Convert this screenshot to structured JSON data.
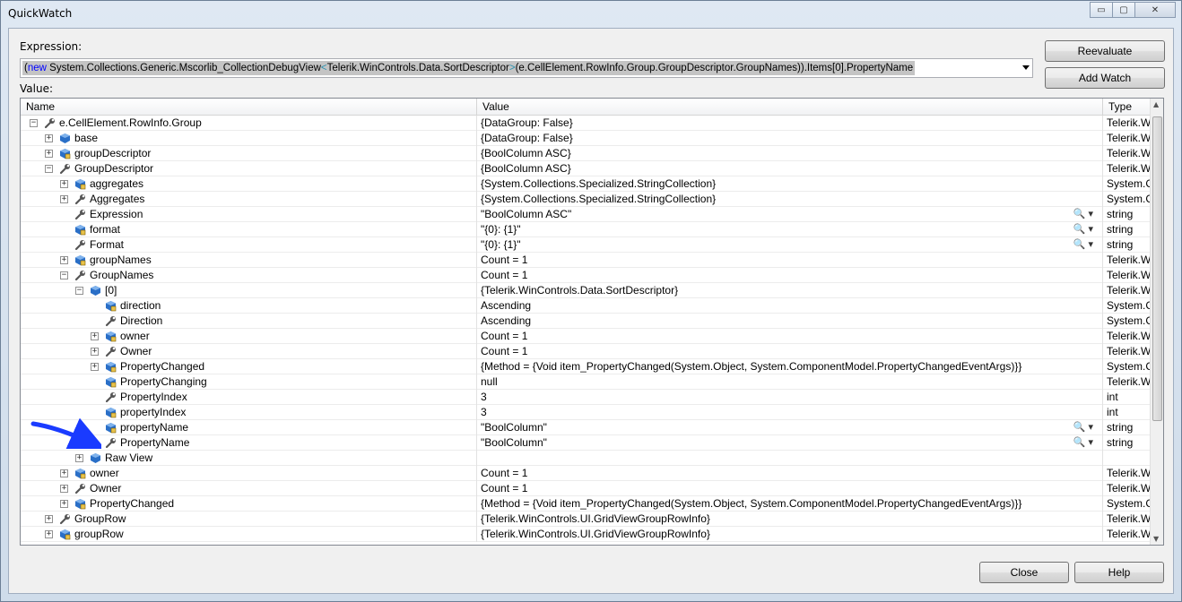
{
  "window": {
    "title": "QuickWatch",
    "minimize": "▭",
    "maximize": "▢",
    "close": "✕"
  },
  "expression": {
    "label": "Expression:",
    "parts": [
      {
        "text": "(",
        "cls": "d"
      },
      {
        "text": "new",
        "cls": "k"
      },
      {
        "text": " System.Collections.Generic.Mscorlib_CollectionDebugView",
        "cls": "d"
      },
      {
        "text": "<",
        "cls": "t"
      },
      {
        "text": "Telerik.WinControls.Data.SortDescriptor",
        "cls": "d"
      },
      {
        "text": ">",
        "cls": "t"
      },
      {
        "text": "(e.CellElement.RowInfo.Group.GroupDescriptor.GroupNames)).Items[0].PropertyName",
        "cls": "d"
      }
    ]
  },
  "buttons": {
    "reevaluate": "Reevaluate",
    "add_watch": "Add Watch",
    "close": "Close",
    "help": "Help"
  },
  "value_label": "Value:",
  "columns": {
    "name": "Name",
    "value": "Value",
    "type": "Type"
  },
  "rows": [
    {
      "depth": 0,
      "expander": "minus",
      "icon": "wrench",
      "name": "e.CellElement.RowInfo.Group",
      "value": "{DataGroup: False}",
      "type": "Telerik.W",
      "mag": false
    },
    {
      "depth": 1,
      "expander": "plus",
      "icon": "cube",
      "name": "base",
      "value": "{DataGroup: False}",
      "type": "Telerik.W",
      "mag": false
    },
    {
      "depth": 1,
      "expander": "plus",
      "icon": "cube-lock",
      "name": "groupDescriptor",
      "value": "{BoolColumn ASC}",
      "type": "Telerik.W",
      "mag": false
    },
    {
      "depth": 1,
      "expander": "minus",
      "icon": "wrench",
      "name": "GroupDescriptor",
      "value": "{BoolColumn ASC}",
      "type": "Telerik.W",
      "mag": false
    },
    {
      "depth": 2,
      "expander": "plus",
      "icon": "cube-lock",
      "name": "aggregates",
      "value": "{System.Collections.Specialized.StringCollection}",
      "type": "System.C",
      "mag": false
    },
    {
      "depth": 2,
      "expander": "plus",
      "icon": "wrench",
      "name": "Aggregates",
      "value": "{System.Collections.Specialized.StringCollection}",
      "type": "System.C",
      "mag": false
    },
    {
      "depth": 2,
      "expander": "none",
      "icon": "wrench",
      "name": "Expression",
      "value": "\"BoolColumn ASC\"",
      "type": "string",
      "mag": true
    },
    {
      "depth": 2,
      "expander": "none",
      "icon": "cube-lock",
      "name": "format",
      "value": "\"{0}: {1}\"",
      "type": "string",
      "mag": true
    },
    {
      "depth": 2,
      "expander": "none",
      "icon": "wrench",
      "name": "Format",
      "value": "\"{0}: {1}\"",
      "type": "string",
      "mag": true
    },
    {
      "depth": 2,
      "expander": "plus",
      "icon": "cube-lock",
      "name": "groupNames",
      "value": "Count = 1",
      "type": "Telerik.W",
      "mag": false
    },
    {
      "depth": 2,
      "expander": "minus",
      "icon": "wrench",
      "name": "GroupNames",
      "value": "Count = 1",
      "type": "Telerik.W",
      "mag": false
    },
    {
      "depth": 3,
      "expander": "minus",
      "icon": "cube",
      "name": "[0]",
      "value": "{Telerik.WinControls.Data.SortDescriptor}",
      "type": "Telerik.W",
      "mag": false
    },
    {
      "depth": 4,
      "expander": "none",
      "icon": "cube-lock",
      "name": "direction",
      "value": "Ascending",
      "type": "System.C",
      "mag": false
    },
    {
      "depth": 4,
      "expander": "none",
      "icon": "wrench",
      "name": "Direction",
      "value": "Ascending",
      "type": "System.C",
      "mag": false
    },
    {
      "depth": 4,
      "expander": "plus",
      "icon": "cube-lock",
      "name": "owner",
      "value": "Count = 1",
      "type": "Telerik.W",
      "mag": false
    },
    {
      "depth": 4,
      "expander": "plus",
      "icon": "wrench",
      "name": "Owner",
      "value": "Count = 1",
      "type": "Telerik.W",
      "mag": false
    },
    {
      "depth": 4,
      "expander": "plus",
      "icon": "cube-lock",
      "name": "PropertyChanged",
      "value": "{Method = {Void item_PropertyChanged(System.Object, System.ComponentModel.PropertyChangedEventArgs)}}",
      "type": "System.C",
      "mag": false
    },
    {
      "depth": 4,
      "expander": "none",
      "icon": "cube-lock",
      "name": "PropertyChanging",
      "value": "null",
      "type": "Telerik.W",
      "mag": false
    },
    {
      "depth": 4,
      "expander": "none",
      "icon": "wrench",
      "name": "PropertyIndex",
      "value": "3",
      "type": "int",
      "mag": false
    },
    {
      "depth": 4,
      "expander": "none",
      "icon": "cube-lock",
      "name": "propertyIndex",
      "value": "3",
      "type": "int",
      "mag": false
    },
    {
      "depth": 4,
      "expander": "none",
      "icon": "cube-lock",
      "name": "propertyName",
      "value": "\"BoolColumn\"",
      "type": "string",
      "mag": true
    },
    {
      "depth": 4,
      "expander": "none",
      "icon": "wrench",
      "name": "PropertyName",
      "value": "\"BoolColumn\"",
      "type": "string",
      "mag": true
    },
    {
      "depth": 3,
      "expander": "plus",
      "icon": "cube",
      "name": "Raw View",
      "value": "",
      "type": "",
      "mag": false
    },
    {
      "depth": 2,
      "expander": "plus",
      "icon": "cube-lock",
      "name": "owner",
      "value": "Count = 1",
      "type": "Telerik.W",
      "mag": false
    },
    {
      "depth": 2,
      "expander": "plus",
      "icon": "wrench",
      "name": "Owner",
      "value": "Count = 1",
      "type": "Telerik.W",
      "mag": false
    },
    {
      "depth": 2,
      "expander": "plus",
      "icon": "cube-lock",
      "name": "PropertyChanged",
      "value": "{Method = {Void item_PropertyChanged(System.Object, System.ComponentModel.PropertyChangedEventArgs)}}",
      "type": "System.C",
      "mag": false
    },
    {
      "depth": 1,
      "expander": "plus",
      "icon": "wrench",
      "name": "GroupRow",
      "value": "{Telerik.WinControls.UI.GridViewGroupRowInfo}",
      "type": "Telerik.W",
      "mag": false
    },
    {
      "depth": 1,
      "expander": "plus",
      "icon": "cube-lock",
      "name": "groupRow",
      "value": "{Telerik.WinControls.UI.GridViewGroupRowInfo}",
      "type": "Telerik.W",
      "mag": false
    }
  ],
  "magnifier_glyph": "🔍 ▾",
  "colors": {
    "arrow": "#1a3bff",
    "icon_blue": "#2a6fc7",
    "wrench": "#555555"
  }
}
